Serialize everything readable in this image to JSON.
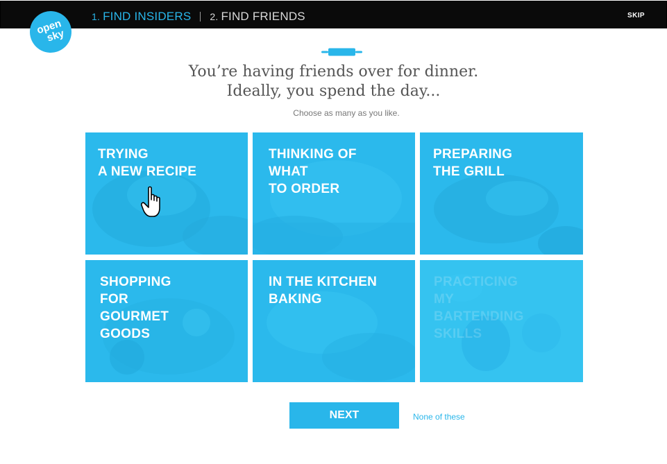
{
  "header": {
    "steps": [
      {
        "num": "1.",
        "label": "FIND INSIDERS",
        "active": true
      },
      {
        "num": "2.",
        "label": "FIND FRIENDS",
        "active": false
      }
    ],
    "skip_label": "SKIP"
  },
  "logo": {
    "line1": "open",
    "line2": "sky"
  },
  "question": {
    "line1": "You’re having friends over for dinner.",
    "line2": "Ideally, you spend the day...",
    "instruction": "Choose as many as you like."
  },
  "options": [
    {
      "label": "TRYING\nA NEW RECIPE"
    },
    {
      "label": "THINKING OF\nWHAT\nTO ORDER"
    },
    {
      "label": "PREPARING\nTHE GRILL"
    },
    {
      "label": "SHOPPING\nFOR\nGOURMET\nGOODS"
    },
    {
      "label": "IN THE KITCHEN\nBAKING"
    },
    {
      "label": "PRACTICING\nMY\nBARTENDING\nSKILLS"
    }
  ],
  "footer": {
    "next_label": "NEXT",
    "none_label": "None of these"
  },
  "colors": {
    "accent": "#29b6ea",
    "topbar": "#0a0a0a",
    "tile": "#2bb9ec"
  },
  "icons": [
    "rolling-pin-icon",
    "hand-pointer-cursor-icon"
  ]
}
